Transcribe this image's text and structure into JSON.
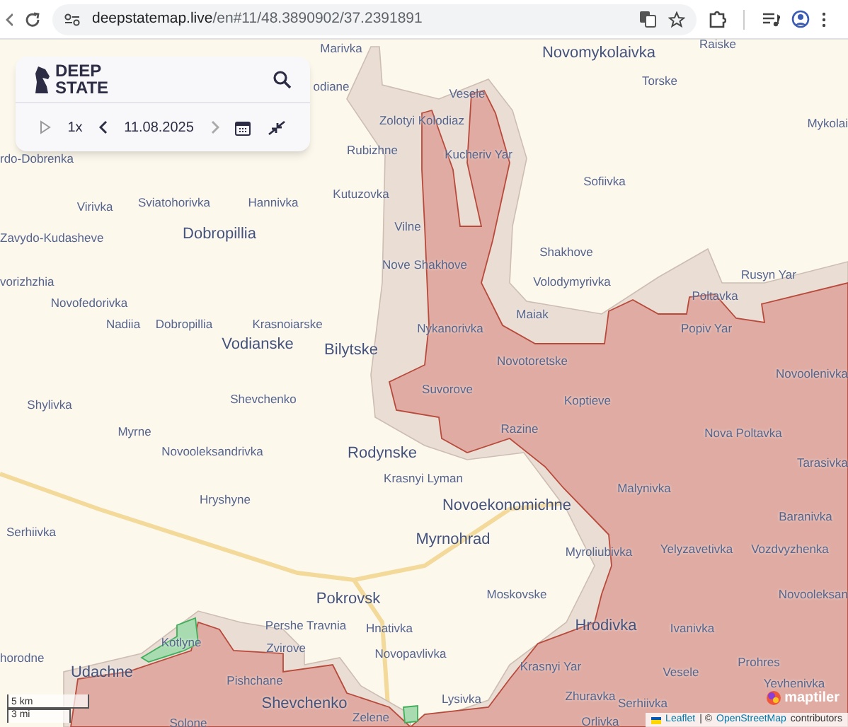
{
  "browser": {
    "url_domain": "deepstatemap.live",
    "url_path": "/en#11/48.3890902/37.2391891"
  },
  "panel": {
    "logo": [
      "DEEP",
      "STATE"
    ],
    "speed": "1x",
    "date": "11.08.2025",
    "next_disabled": true
  },
  "map_labels": [
    {
      "text": "Marivka",
      "kind": "town"
    },
    {
      "text": "Novomykolaivka",
      "kind": "city"
    },
    {
      "text": "Raiske",
      "kind": "town"
    },
    {
      "text": "Torske",
      "kind": "town"
    },
    {
      "text": "Mykolai",
      "kind": "town"
    },
    {
      "text": "odiane",
      "kind": "town"
    },
    {
      "text": "Vesele",
      "kind": "town"
    },
    {
      "text": "Zolotyi Kolodiaz",
      "kind": "town"
    },
    {
      "text": "rdo-Dobrenka",
      "kind": "town"
    },
    {
      "text": "Rubizhne",
      "kind": "town"
    },
    {
      "text": "Kucheriv Yar",
      "kind": "town"
    },
    {
      "text": "Sofiivka",
      "kind": "town"
    },
    {
      "text": "Kutuzovka",
      "kind": "town"
    },
    {
      "text": "Virivka",
      "kind": "town"
    },
    {
      "text": "Sviatohorivka",
      "kind": "town"
    },
    {
      "text": "Hannivka",
      "kind": "town"
    },
    {
      "text": "Vilne",
      "kind": "town"
    },
    {
      "text": "Zavydo-Kudasheve",
      "kind": "town"
    },
    {
      "text": "Dobropillia",
      "kind": "city"
    },
    {
      "text": "Shakhove",
      "kind": "town"
    },
    {
      "text": "Nove Shakhove",
      "kind": "town"
    },
    {
      "text": "Volodymyrivka",
      "kind": "town"
    },
    {
      "text": "Rusyn Yar",
      "kind": "town"
    },
    {
      "text": "Poltavka",
      "kind": "town"
    },
    {
      "text": "vorizhzhia",
      "kind": "town"
    },
    {
      "text": "Novofedorivka",
      "kind": "town"
    },
    {
      "text": "Nadiia",
      "kind": "town"
    },
    {
      "text": "Dobropillia",
      "kind": "town"
    },
    {
      "text": "Krasnoiarske",
      "kind": "town"
    },
    {
      "text": "Maiak",
      "kind": "town"
    },
    {
      "text": "Nykanorivka",
      "kind": "town"
    },
    {
      "text": "Popiv Yar",
      "kind": "town"
    },
    {
      "text": "Vodianske",
      "kind": "city"
    },
    {
      "text": "Bilytske",
      "kind": "city"
    },
    {
      "text": "Novotoretske",
      "kind": "town"
    },
    {
      "text": "Novoolenivka",
      "kind": "town"
    },
    {
      "text": "Suvorove",
      "kind": "town"
    },
    {
      "text": "Shylivka",
      "kind": "town"
    },
    {
      "text": "Shevchenko",
      "kind": "town"
    },
    {
      "text": "Koptieve",
      "kind": "town"
    },
    {
      "text": "Myrne",
      "kind": "town"
    },
    {
      "text": "Razine",
      "kind": "town"
    },
    {
      "text": "Nova Poltavka",
      "kind": "town"
    },
    {
      "text": "Novooleksandrivka",
      "kind": "town"
    },
    {
      "text": "Rodynske",
      "kind": "city"
    },
    {
      "text": "Tarasivka",
      "kind": "town"
    },
    {
      "text": "Krasnyi Lyman",
      "kind": "town"
    },
    {
      "text": "Malynivka",
      "kind": "town"
    },
    {
      "text": "Hryshyne",
      "kind": "town"
    },
    {
      "text": "Novoekonomichne",
      "kind": "city"
    },
    {
      "text": "Baranivka",
      "kind": "town"
    },
    {
      "text": "Serhiivka",
      "kind": "town"
    },
    {
      "text": "Myrnohrad",
      "kind": "city"
    },
    {
      "text": "Myroliubivka",
      "kind": "town"
    },
    {
      "text": "Yelyzavetivka",
      "kind": "town"
    },
    {
      "text": "Vozdvyzhenka",
      "kind": "town"
    },
    {
      "text": "Pokrovsk",
      "kind": "city"
    },
    {
      "text": "Moskovske",
      "kind": "town"
    },
    {
      "text": "Novooleksan",
      "kind": "town"
    },
    {
      "text": "Pershe Travnia",
      "kind": "town"
    },
    {
      "text": "Hnativka",
      "kind": "town"
    },
    {
      "text": "Hrodivka",
      "kind": "city"
    },
    {
      "text": "Ivanivka",
      "kind": "town"
    },
    {
      "text": "horodne",
      "kind": "town"
    },
    {
      "text": "Kotlyne",
      "kind": "town"
    },
    {
      "text": "Zvirove",
      "kind": "town"
    },
    {
      "text": "Novopavlivka",
      "kind": "town"
    },
    {
      "text": "Udachne",
      "kind": "city"
    },
    {
      "text": "Krasnyi Yar",
      "kind": "town"
    },
    {
      "text": "Vesele",
      "kind": "town"
    },
    {
      "text": "Prohres",
      "kind": "town"
    },
    {
      "text": "Pishchane",
      "kind": "town"
    },
    {
      "text": "Yevhenivka",
      "kind": "town"
    },
    {
      "text": "Shevchenko",
      "kind": "city"
    },
    {
      "text": "Lysivka",
      "kind": "town"
    },
    {
      "text": "Zhuravka",
      "kind": "town"
    },
    {
      "text": "Serhiivka",
      "kind": "town"
    },
    {
      "text": "Solone",
      "kind": "town"
    },
    {
      "text": "Zelene",
      "kind": "town"
    },
    {
      "text": "Orlivka",
      "kind": "town"
    }
  ],
  "scale": [
    "5 km",
    "3 mi"
  ],
  "attribution": {
    "leaflet": "Leaflet",
    "separator": "| ©",
    "osm": "OpenStreetMap",
    "rest": "contributors"
  },
  "maptiler": "maptiler"
}
